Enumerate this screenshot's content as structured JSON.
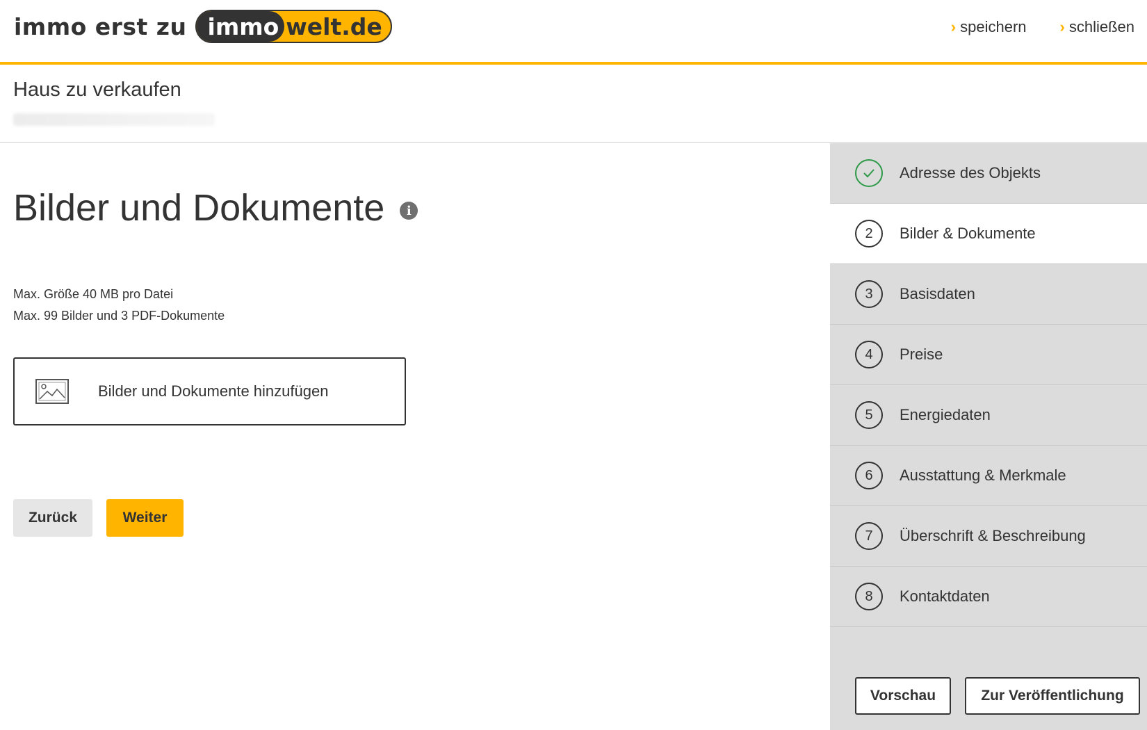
{
  "header": {
    "logo_prefix": "immo erst zu",
    "logo_pill_dark": "immo",
    "logo_pill_light": "welt.de",
    "save_label": "speichern",
    "close_label": "schließen",
    "accent_color": "#ffb400"
  },
  "subheader": {
    "title": "Haus zu verkaufen"
  },
  "main": {
    "page_title": "Bilder und Dokumente",
    "limit_size": "Max. Größe 40 MB pro Datei",
    "limit_count": "Max. 99 Bilder und 3 PDF-Dokumente",
    "upload_label": "Bilder und Dokumente hinzufügen",
    "back_label": "Zurück",
    "next_label": "Weiter"
  },
  "sidebar": {
    "steps": [
      {
        "number": "1",
        "label": "Adresse des Objekts",
        "state": "done"
      },
      {
        "number": "2",
        "label": "Bilder & Dokumente",
        "state": "active"
      },
      {
        "number": "3",
        "label": "Basisdaten",
        "state": "todo"
      },
      {
        "number": "4",
        "label": "Preise",
        "state": "todo"
      },
      {
        "number": "5",
        "label": "Energiedaten",
        "state": "todo"
      },
      {
        "number": "6",
        "label": "Ausstattung & Merkmale",
        "state": "todo"
      },
      {
        "number": "7",
        "label": "Überschrift & Beschreibung",
        "state": "todo"
      },
      {
        "number": "8",
        "label": "Kontaktdaten",
        "state": "todo"
      }
    ],
    "preview_label": "Vorschau",
    "publish_label": "Zur Veröffentlichung"
  }
}
